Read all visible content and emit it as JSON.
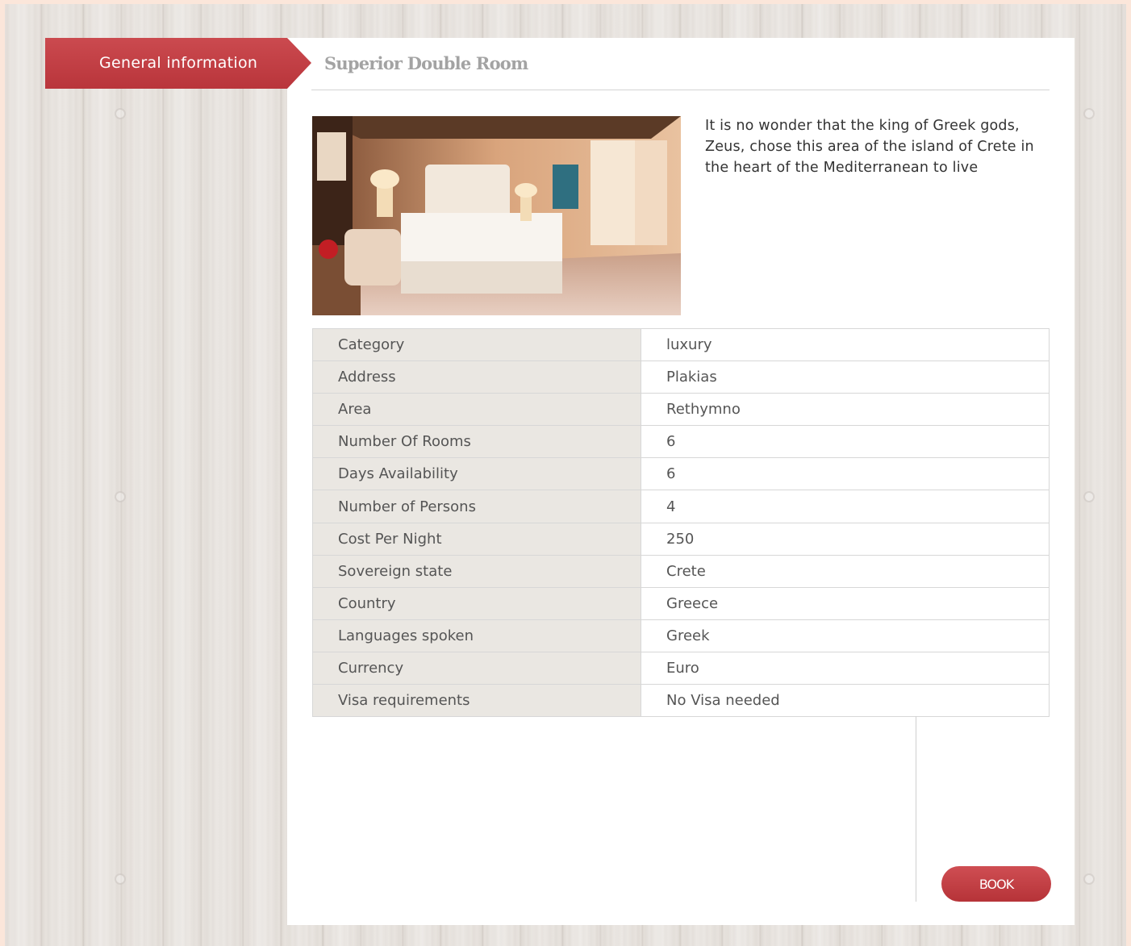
{
  "ribbon": {
    "label": "General information"
  },
  "room": {
    "title": "Superior Double Room",
    "description": "It is no wonder that the king of Greek gods, Zeus, chose this area of the island of Crete in the heart of the Mediterranean to live"
  },
  "details": [
    {
      "key": "Category",
      "value": "luxury"
    },
    {
      "key": "Address",
      "value": "Plakias"
    },
    {
      "key": "Area",
      "value": "Rethymno"
    },
    {
      "key": "Number Of Rooms",
      "value": "6"
    },
    {
      "key": "Days Availability",
      "value": "6"
    },
    {
      "key": "Number of Persons",
      "value": "4"
    },
    {
      "key": "Cost Per Night",
      "value": "250"
    },
    {
      "key": "Sovereign state",
      "value": "Crete"
    },
    {
      "key": "Country",
      "value": "Greece"
    },
    {
      "key": "Languages spoken",
      "value": "Greek"
    },
    {
      "key": "Currency",
      "value": "Euro"
    },
    {
      "key": "Visa requirements",
      "value": "No Visa needed"
    }
  ],
  "actions": {
    "book_label": "BOOK"
  },
  "colors": {
    "accent": "#c0393e",
    "row_key_bg": "#eae7e2",
    "title": "#a3a3a3"
  }
}
